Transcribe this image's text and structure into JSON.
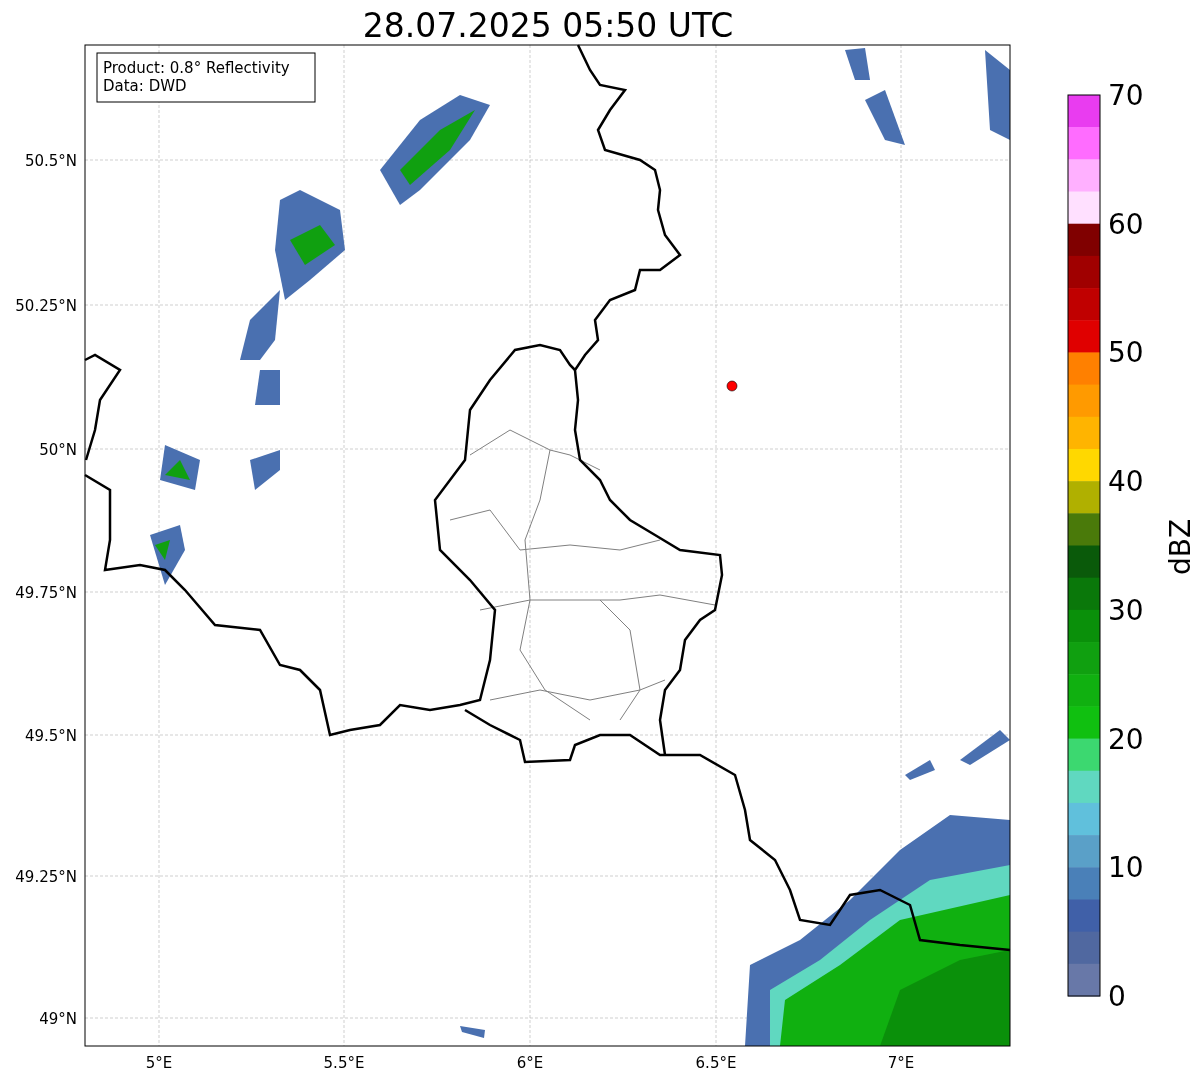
{
  "title": "28.07.2025 05:50 UTC",
  "legend": [
    "Product: 0.8° Reflectivity",
    "Data: DWD"
  ],
  "y_ticks": [
    "50.5°N",
    "50.25°N",
    "50°N",
    "49.75°N",
    "49.5°N",
    "49.25°N",
    "49°N"
  ],
  "x_ticks": [
    "5°E",
    "5.5°E",
    "6°E",
    "6.5°E",
    "7°E"
  ],
  "colorbar": {
    "label": "dBZ",
    "ticks": [
      "70",
      "60",
      "50",
      "40",
      "30",
      "20",
      "10",
      "0"
    ],
    "segments": [
      {
        "color": "#e93cf0"
      },
      {
        "color": "#ff6cff"
      },
      {
        "color": "#ffb0ff"
      },
      {
        "color": "#ffe0ff"
      },
      {
        "color": "#800000"
      },
      {
        "color": "#a00000"
      },
      {
        "color": "#c00000"
      },
      {
        "color": "#e00000"
      },
      {
        "color": "#ff8000"
      },
      {
        "color": "#ff9a00"
      },
      {
        "color": "#ffb400"
      },
      {
        "color": "#ffd800"
      },
      {
        "color": "#b0b000"
      },
      {
        "color": "#4a7a0a"
      },
      {
        "color": "#0a5a0a"
      },
      {
        "color": "#0a780a"
      },
      {
        "color": "#0a900a"
      },
      {
        "color": "#10a010"
      },
      {
        "color": "#10b010"
      },
      {
        "color": "#10c010"
      },
      {
        "color": "#3cd870"
      },
      {
        "color": "#60d8c0"
      },
      {
        "color": "#60c0dc"
      },
      {
        "color": "#5aa0c8"
      },
      {
        "color": "#4a80b8"
      },
      {
        "color": "#4060a8"
      },
      {
        "color": "#5068a0"
      },
      {
        "color": "#6878a8"
      }
    ]
  }
}
